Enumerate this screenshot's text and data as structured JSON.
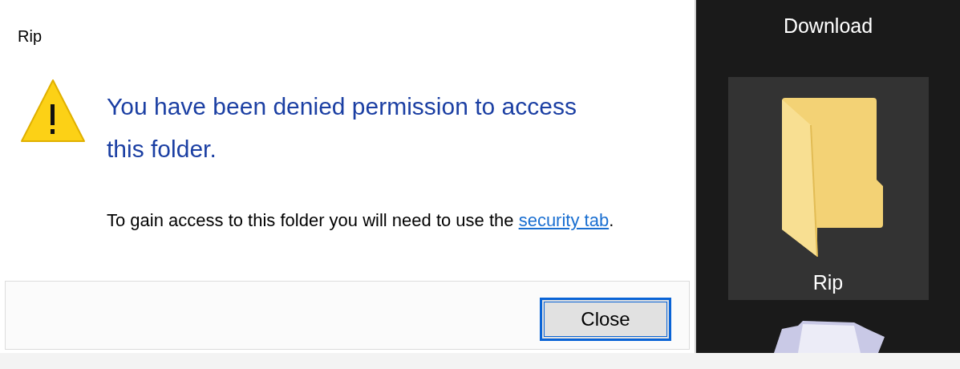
{
  "dialog": {
    "title": "Rip",
    "heading": "You have been denied permission to access this folder.",
    "message": "To gain access to this folder you will need to use the",
    "link": "security tab",
    "after_link": ".",
    "buttons": [
      {
        "label": "Close",
        "focused": true
      }
    ]
  },
  "explorer": {
    "items": [
      {
        "label": "Download",
        "kind": "label"
      },
      {
        "label": "Rip",
        "selected": true,
        "kind": "folder"
      },
      {
        "kind": "stack"
      }
    ]
  }
}
